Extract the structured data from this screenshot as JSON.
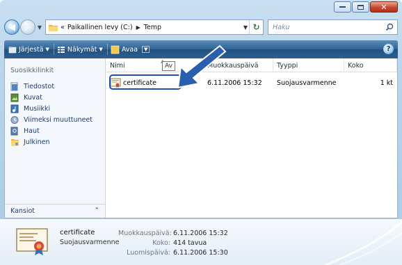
{
  "address": {
    "location": "Paikallinen levy (C:)",
    "folder": "Temp",
    "overflow": "«",
    "search_placeholder": "Haku"
  },
  "toolbar": {
    "organize_label": "Järjestä",
    "views_label": "Näkymät",
    "open_label": "Avaa"
  },
  "nav_pane": {
    "heading": "Suosikkilinkit",
    "items": [
      {
        "label": "Tiedostot",
        "icon": "documents-icon"
      },
      {
        "label": "Kuvat",
        "icon": "pictures-icon"
      },
      {
        "label": "Musiikki",
        "icon": "music-icon"
      },
      {
        "label": "Viimeksi muuttuneet",
        "icon": "recently-changed-icon"
      },
      {
        "label": "Haut",
        "icon": "searches-icon"
      },
      {
        "label": "Julkinen",
        "icon": "public-folder-icon"
      }
    ],
    "folders_label": "Kansiot"
  },
  "file_list": {
    "columns": [
      "Nimi",
      "Muokkauspäivä",
      "Tyyppi",
      "Koko"
    ],
    "tooltip": "Av",
    "rows": [
      {
        "name": "certificate",
        "modified": "6.11.2006 15:32",
        "type": "Suojausvarmenne",
        "size": "1 kt"
      }
    ]
  },
  "details": {
    "name": "certificate",
    "type": "Suojausvarmenne",
    "modified_label": "Muokkauspäivä:",
    "modified_value": "6.11.2006 15:32",
    "size_label": "Koko:",
    "size_value": "414 tavua",
    "created_label": "Luomispäivä:",
    "created_value": "6.11.2006 15:30"
  },
  "colors": {
    "toolbar": "#2c6090",
    "highlight_box": "#1f4ea8",
    "arrow": "#2a5fb0"
  }
}
